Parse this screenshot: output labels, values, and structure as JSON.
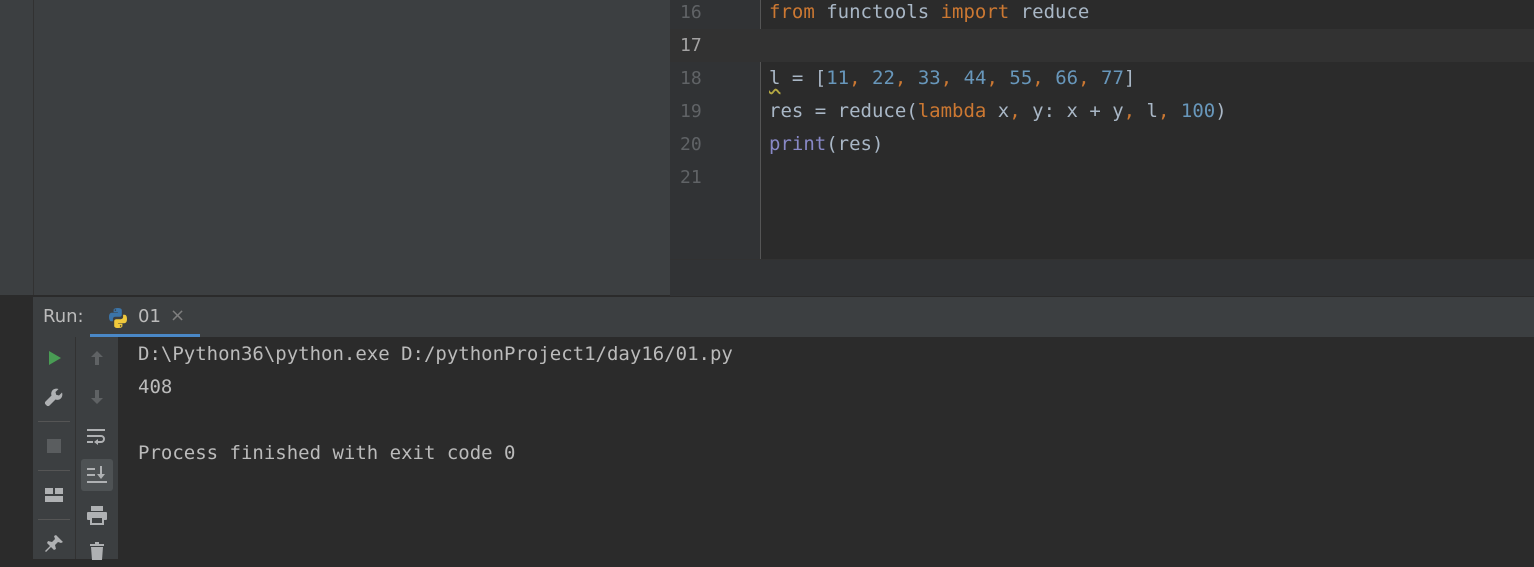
{
  "editor": {
    "lines": [
      {
        "number": "16",
        "text": "from functools import reduce"
      },
      {
        "number": "17",
        "text": ""
      },
      {
        "number": "18",
        "text": "l = [11, 22, 33, 44, 55, 66, 77]"
      },
      {
        "number": "19",
        "text": "res = reduce(lambda x, y: x + y, l, 100)"
      },
      {
        "number": "20",
        "text": "print(res)"
      },
      {
        "number": "21",
        "text": ""
      }
    ],
    "current_line": "17"
  },
  "run": {
    "label": "Run:",
    "tab_label": "01",
    "tab_close": "×",
    "icons": {
      "left": [
        "run-icon",
        "wrench-icon",
        "stop-icon",
        "layout-icon",
        "pin-icon"
      ],
      "right": [
        "arrow-up-icon",
        "arrow-down-icon",
        "soft-wrap-icon",
        "scroll-to-end-icon",
        "print-icon",
        "trash-icon"
      ]
    }
  },
  "console": {
    "lines": [
      "D:\\Python36\\python.exe D:/pythonProject1/day16/01.py",
      "408",
      "",
      "Process finished with exit code 0"
    ]
  },
  "colors": {
    "keyword": "#cc7832",
    "number": "#6897bb",
    "builtin": "#8888c6",
    "text": "#a9b7c6",
    "accent": "#4a88c7"
  }
}
